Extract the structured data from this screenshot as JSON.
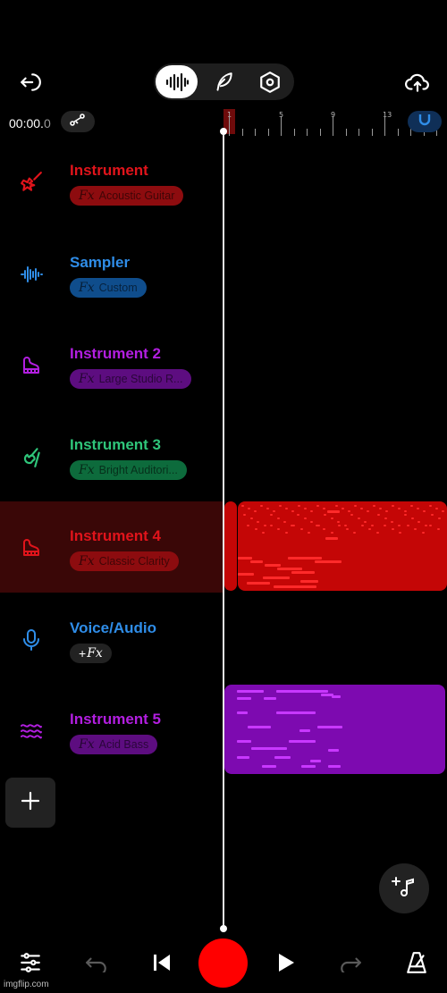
{
  "header": {
    "timecode_main": "00:00.",
    "timecode_frac": "0"
  },
  "ruler": {
    "bar_labels": [
      "1",
      "5",
      "9",
      "13"
    ]
  },
  "tracks": [
    {
      "name": "Instrument",
      "fx_prefix": "Fx",
      "fx_label": "Acoustic Guitar",
      "color": "#e0141b",
      "pill_color": "#8d0c0f",
      "icon": "electric-guitar-icon"
    },
    {
      "name": "Sampler",
      "fx_prefix": "Fx",
      "fx_label": "Custom",
      "color": "#2f8de8",
      "pill_color": "#0f4d8c",
      "icon": "waveform-icon"
    },
    {
      "name": "Instrument 2",
      "fx_prefix": "Fx",
      "fx_label": "Large Studio R...",
      "color": "#b21ee0",
      "pill_color": "#5d0d80",
      "icon": "grand-piano-icon"
    },
    {
      "name": "Instrument 3",
      "fx_prefix": "Fx",
      "fx_label": "Bright Auditori...",
      "color": "#2fc57a",
      "pill_color": "#0d6b3c",
      "icon": "violin-icon"
    },
    {
      "name": "Instrument 4",
      "fx_prefix": "Fx",
      "fx_label": "Classic Clarity",
      "color": "#e0141b",
      "pill_color": "#8d0c0f",
      "icon": "grand-piano-icon"
    },
    {
      "name": "Voice/Audio",
      "fx_prefix": "+",
      "fx_label": "Fx",
      "color": "#2f8de8",
      "pill_color": "#222222",
      "icon": "microphone-icon"
    },
    {
      "name": "Instrument 5",
      "fx_prefix": "Fx",
      "fx_label": "Acid Bass",
      "color": "#b21ee0",
      "pill_color": "#5d0d80",
      "icon": "waves-icon"
    }
  ],
  "colors": {
    "accent_red": "#ff0000",
    "record": "#ff0000",
    "magnet_blue": "#2f8de8"
  },
  "watermark": "imgflip.com"
}
